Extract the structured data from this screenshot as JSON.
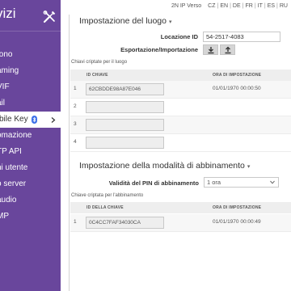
{
  "sidebar": {
    "title": "vizi",
    "items": [
      {
        "label": "fono"
      },
      {
        "label": "aming"
      },
      {
        "label": "VIF"
      },
      {
        "label": "ail"
      },
      {
        "label": "bile Key"
      },
      {
        "label": "omazione"
      },
      {
        "label": "TP API"
      },
      {
        "label": "ni utente"
      },
      {
        "label": "o server"
      },
      {
        "label": "audio"
      },
      {
        "label": "MP"
      }
    ]
  },
  "topbar": {
    "product": "2N IP Verso",
    "languages": [
      "CZ",
      "EN",
      "DE",
      "FR",
      "IT",
      "ES",
      "RU"
    ]
  },
  "location_section": {
    "title": "Impostazione del luogo",
    "location_id_label": "Locazione ID",
    "location_id_value": "54-2517-4083",
    "export_import_label": "Esportazione/Importazione",
    "encrypted_keys_label": "Chiavi criptate per il luogo",
    "table": {
      "col_key": "ID CHIAVE",
      "col_time": "ORA DI IMPOSTAZIONE",
      "rows": [
        {
          "num": "1",
          "key": "62CBDDE98A87E046",
          "time": "01/01/1970 00:00:50"
        },
        {
          "num": "2",
          "key": "",
          "time": ""
        },
        {
          "num": "3",
          "key": "",
          "time": ""
        },
        {
          "num": "4",
          "key": "",
          "time": ""
        }
      ]
    }
  },
  "pairing_section": {
    "title": "Impostazione della modalità di abbinamento",
    "pin_validity_label": "Validità del PIN di abbinamento",
    "pin_validity_value": "1 ora",
    "encrypted_key_label": "Chiave criptata per l'abbinamento",
    "table": {
      "col_key": "ID DELLA CHIAVE",
      "col_time": "ORA DI IMPOSTAZIONE",
      "rows": [
        {
          "num": "1",
          "key": "0C4CC7FAF34030CA",
          "time": "01/01/1970 00:00:49"
        }
      ]
    }
  },
  "colors": {
    "sidebar_bg": "#69469c",
    "accent_purple": "#6a4a9c",
    "table_header_bg": "#eeeeee"
  },
  "icons": [
    "wrench-screwdriver-icon",
    "bluetooth-icon",
    "chevron-right-icon",
    "chevron-down-icon",
    "download-icon",
    "upload-icon"
  ]
}
